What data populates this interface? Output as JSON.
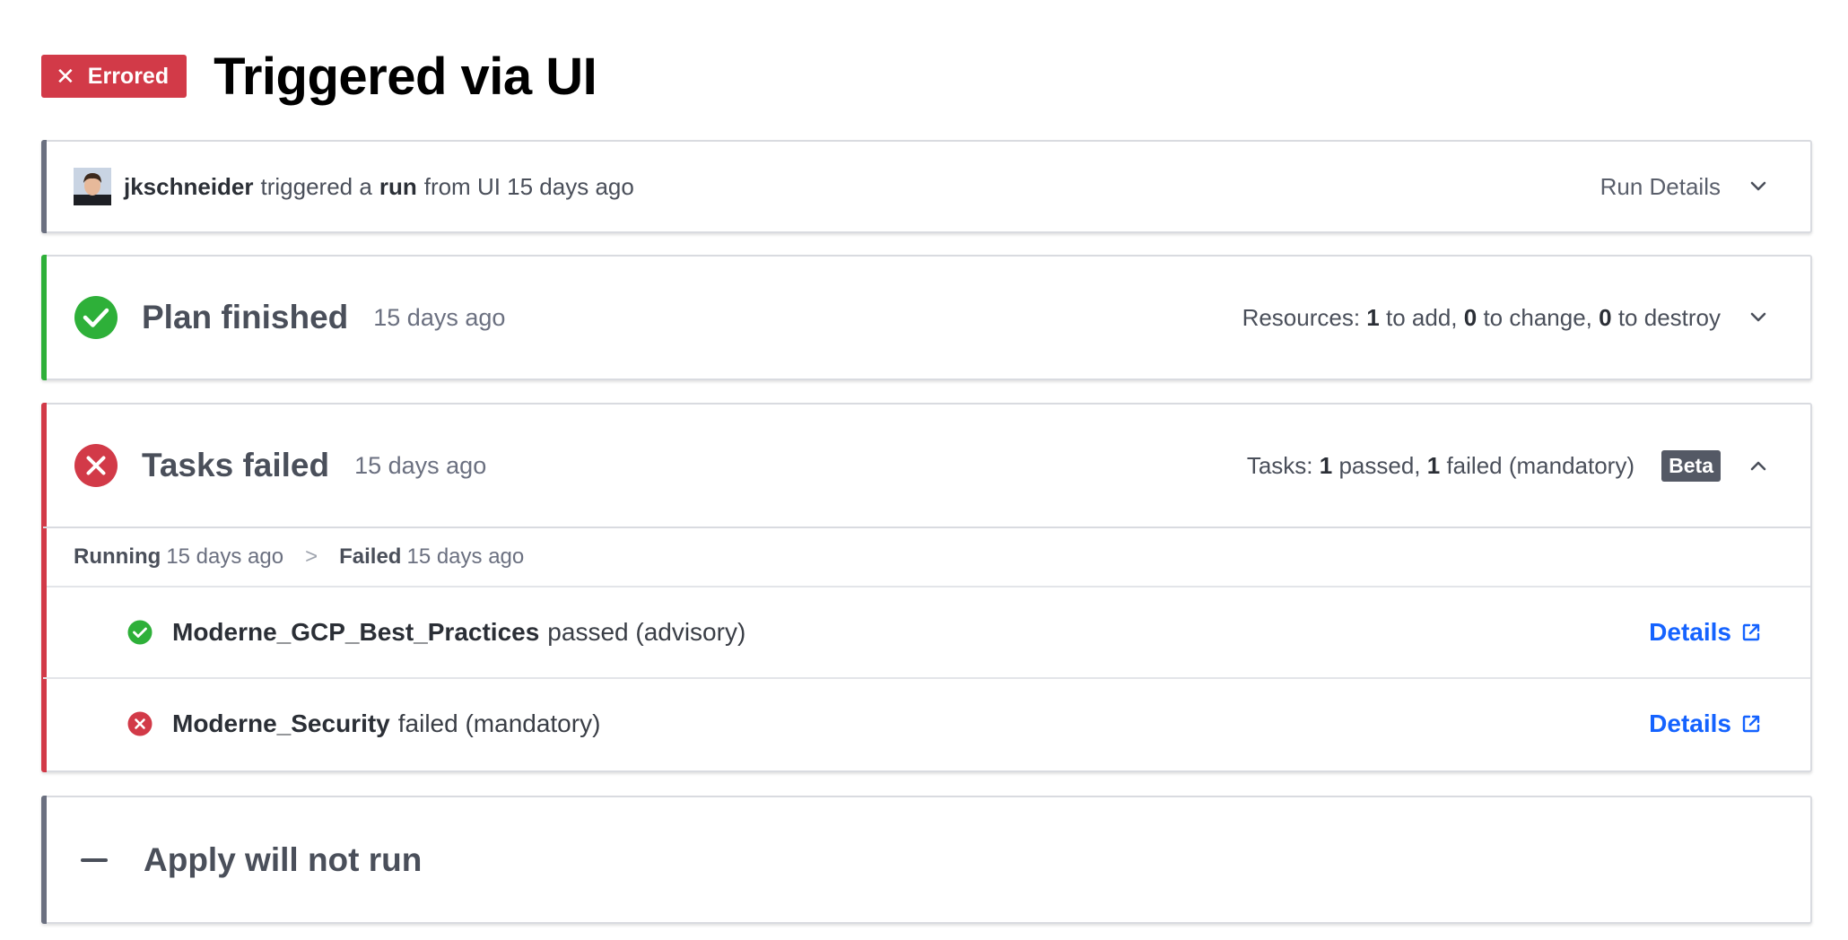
{
  "header": {
    "status_badge": "Errored",
    "title": "Triggered via UI"
  },
  "run_info": {
    "username": "jkschneider",
    "text_triggered": "triggered a",
    "text_run": "run",
    "text_from": "from UI 15 days ago",
    "run_details_label": "Run Details"
  },
  "plan": {
    "title": "Plan finished",
    "time": "15 days ago",
    "resources_label": "Resources:",
    "add_count": "1",
    "add_text": "to add,",
    "change_count": "0",
    "change_text": "to change,",
    "destroy_count": "0",
    "destroy_text": "to destroy"
  },
  "tasks": {
    "title": "Tasks failed",
    "time": "15 days ago",
    "summary_label": "Tasks:",
    "passed_count": "1",
    "passed_text": "passed,",
    "failed_count": "1",
    "failed_text": "failed (mandatory)",
    "beta_label": "Beta",
    "timeline": {
      "running_label": "Running",
      "running_time": "15 days ago",
      "separator": ">",
      "failed_label": "Failed",
      "failed_time": "15 days ago"
    },
    "items": [
      {
        "name": "Moderne_GCP_Best_Practices",
        "status": "passed (advisory)",
        "result": "passed",
        "details_label": "Details"
      },
      {
        "name": "Moderne_Security",
        "status": "failed (mandatory)",
        "result": "failed",
        "details_label": "Details"
      }
    ]
  },
  "apply": {
    "title": "Apply will not run"
  },
  "colors": {
    "error": "#d23a48",
    "success": "#2eb039",
    "link": "#1563ff",
    "neutral": "#6b7080"
  }
}
